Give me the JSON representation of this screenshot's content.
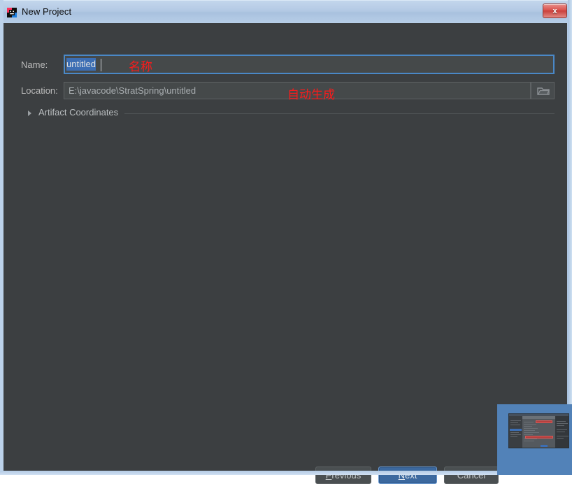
{
  "window": {
    "title": "New Project",
    "app_icon": "intellij-idea-icon",
    "close_label": "x",
    "frame_color": "#b6cbe4",
    "client_background": "#3c3f41"
  },
  "form": {
    "name": {
      "label": "Name:",
      "value": "untitled",
      "selected": true,
      "focused": true,
      "focus_border_color": "#4a88c7",
      "selection_color": "#3c6eb4"
    },
    "location": {
      "label": "Location:",
      "value": "E:\\javacode\\StratSpring\\untitled",
      "browse_icon": "folder-icon"
    },
    "artifact_coordinates": {
      "label": "Artifact Coordinates",
      "expanded": false,
      "chevron_icon": "triangle-right-icon"
    }
  },
  "footer": {
    "previous": {
      "label": "Previous",
      "mnemonic": "P"
    },
    "next": {
      "label": "Next",
      "mnemonic": "N",
      "primary": true,
      "accent_color": "#3c699f"
    },
    "cancel": {
      "label": "Cancel",
      "mnemonic": ""
    }
  },
  "annotations": [
    {
      "text": "名称",
      "color": "#fb1b1b",
      "target": "name-field"
    },
    {
      "text": "自动生成",
      "color": "#fb1b1b",
      "target": "location-field"
    }
  ],
  "taskbar_preview": {
    "background_color": "#5282b8",
    "description": "ide-window-thumbnail"
  }
}
